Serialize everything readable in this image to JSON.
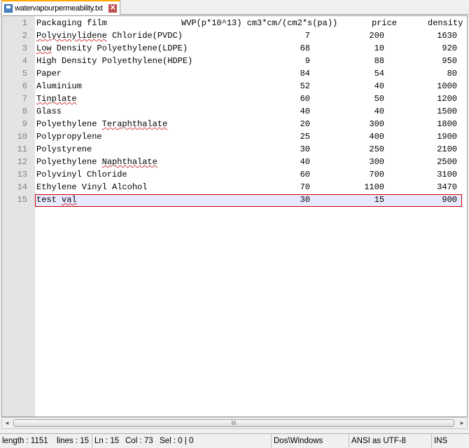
{
  "tab": {
    "filename": "watervapourpermeability.txt",
    "icon": "floppy-save-icon",
    "close": "✕"
  },
  "header": {
    "name": "Packaging film",
    "wvp": "WVP(p*10^13) cm3*cm/(cm2*s(pa))",
    "price": "price",
    "density": "density"
  },
  "rows": [
    {
      "n": "2",
      "name": "Polyvinylidene Chloride(PVDC)",
      "wvp": "7",
      "price": "200",
      "density": "1630"
    },
    {
      "n": "3",
      "name": "Low Density Polyethylene(LDPE)",
      "wvp": "68",
      "price": "10",
      "density": "920"
    },
    {
      "n": "4",
      "name": "High Density Polyethylene(HDPE)",
      "wvp": "9",
      "price": "88",
      "density": "950"
    },
    {
      "n": "5",
      "name": "Paper",
      "wvp": "84",
      "price": "54",
      "density": "80"
    },
    {
      "n": "6",
      "name": "Aluminium",
      "wvp": "52",
      "price": "40",
      "density": "1000"
    },
    {
      "n": "7",
      "name": "Tinplate",
      "wvp": "60",
      "price": "50",
      "density": "1200"
    },
    {
      "n": "8",
      "name": "Glass",
      "wvp": "40",
      "price": "40",
      "density": "1500"
    },
    {
      "n": "9",
      "name": "Polyethylene Teraphthalate",
      "wvp": "20",
      "price": "300",
      "density": "1800"
    },
    {
      "n": "10",
      "name": "Polypropylene",
      "wvp": "25",
      "price": "400",
      "density": "1900"
    },
    {
      "n": "11",
      "name": "Polystyrene",
      "wvp": "30",
      "price": "250",
      "density": "2100"
    },
    {
      "n": "12",
      "name": "Polyethylene Naphthalate",
      "wvp": "40",
      "price": "300",
      "density": "2500"
    },
    {
      "n": "13",
      "name": "Polyvinyl Chloride",
      "wvp": "60",
      "price": "700",
      "density": "3100"
    },
    {
      "n": "14",
      "name": "Ethylene Vinyl Alcohol",
      "wvp": "70",
      "price": "1100",
      "density": "3470"
    },
    {
      "n": "15",
      "name": "test val",
      "wvp": "30",
      "price": "15",
      "density": "900"
    }
  ],
  "scrollbar": {
    "left": "◂",
    "right": "▸",
    "grip": "III"
  },
  "status": {
    "length": "length : 1151",
    "lines": "lines : 15",
    "ln": "Ln : 15",
    "col": "Col : 73",
    "sel": "Sel : 0 | 0",
    "eol": "Dos\\Windows",
    "encoding": "ANSI as UTF-8",
    "mode": "INS"
  }
}
